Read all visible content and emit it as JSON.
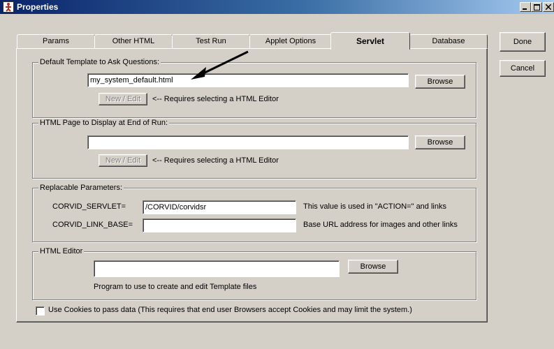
{
  "window": {
    "title": "Properties",
    "app_icon": "app-figure-icon",
    "controls": [
      "minimize-icon",
      "maximize-icon",
      "close-icon"
    ]
  },
  "side_buttons": {
    "done": "Done",
    "cancel": "Cancel"
  },
  "tabs": [
    {
      "label": "Params"
    },
    {
      "label": "Other HTML"
    },
    {
      "label": "Test Run"
    },
    {
      "label": "Applet Options"
    },
    {
      "label": "Servlet"
    },
    {
      "label": "Database"
    }
  ],
  "active_tab": "Servlet",
  "default_template": {
    "title": "Default Template to Ask Questions:",
    "value": "my_system_default.html",
    "browse": "Browse",
    "new_edit": "New / Edit",
    "note": "<-- Requires selecting a HTML Editor"
  },
  "end_page": {
    "title": "HTML Page to Display at End of Run:",
    "value": "",
    "browse": "Browse",
    "new_edit": "New / Edit",
    "note": "<-- Requires selecting a HTML Editor"
  },
  "replaceable": {
    "title": "Replacable Parameters:",
    "servlet_label": "CORVID_SERVLET=",
    "servlet_value": "/CORVID/corvidsr",
    "servlet_help": "This value is used in \"ACTION=\" and links",
    "link_base_label": "CORVID_LINK_BASE=",
    "link_base_value": "",
    "link_base_help": "Base URL address for images and other links"
  },
  "html_editor": {
    "title": "HTML Editor",
    "value": "",
    "browse": "Browse",
    "help": "Program to use to create and edit Template files"
  },
  "cookies": {
    "label": "Use Cookies to pass data (This requires that end user Browsers accept Cookies and may limit the system.)",
    "checked": false
  }
}
